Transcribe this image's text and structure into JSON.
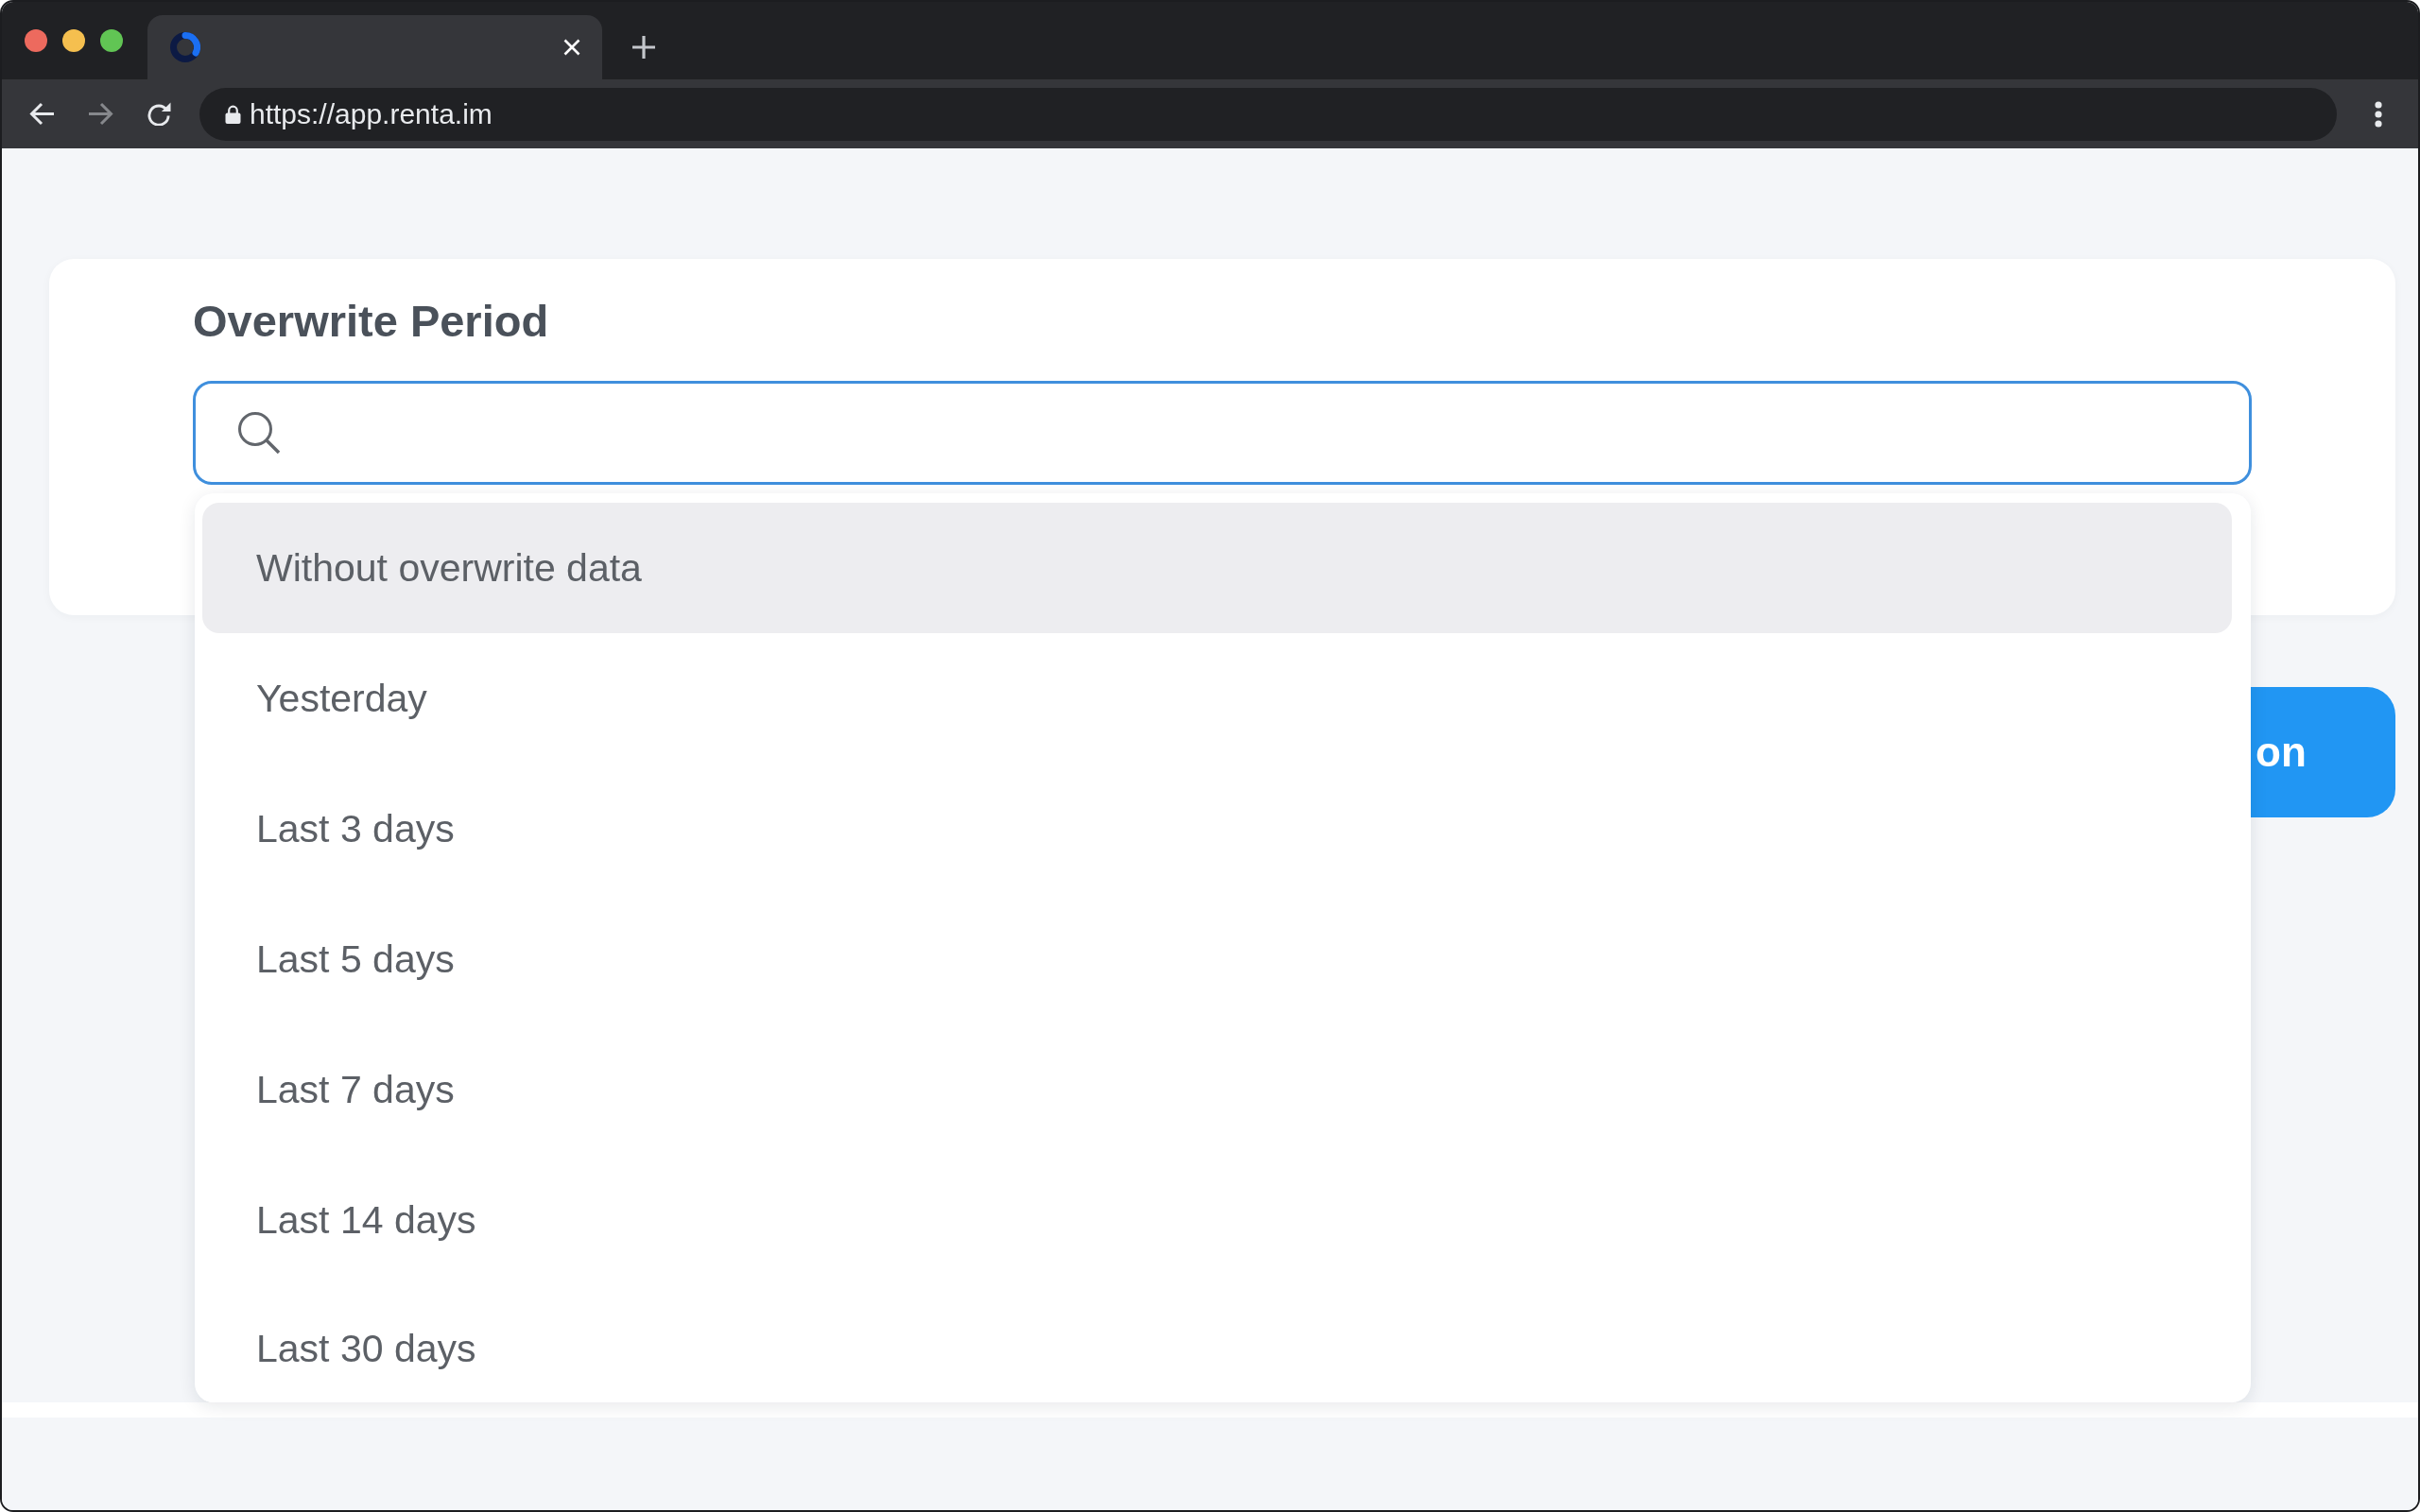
{
  "toolbar": {
    "nav_buttons": [
      {
        "kind": "back",
        "disabled": false
      },
      {
        "kind": "forward",
        "disabled": true
      },
      {
        "kind": "reload",
        "disabled": false
      }
    ],
    "address_bar": {
      "url": "https://app.renta.im",
      "secure": true
    }
  },
  "card": {
    "title": "Overwrite Period",
    "search": {
      "focused": true
    }
  },
  "dropdown": {
    "options": [
      {
        "label": "Without overwrite data",
        "selected": true
      },
      {
        "label": "Yesterday",
        "selected": false
      },
      {
        "label": "Last 3 days",
        "selected": false
      },
      {
        "label": "Last 5 days",
        "selected": false
      },
      {
        "label": "Last 7 days",
        "selected": false
      },
      {
        "label": "Last 14 days",
        "selected": false
      },
      {
        "label": "Last 30 days",
        "selected": false
      }
    ]
  },
  "action_button": {
    "label": "on"
  }
}
